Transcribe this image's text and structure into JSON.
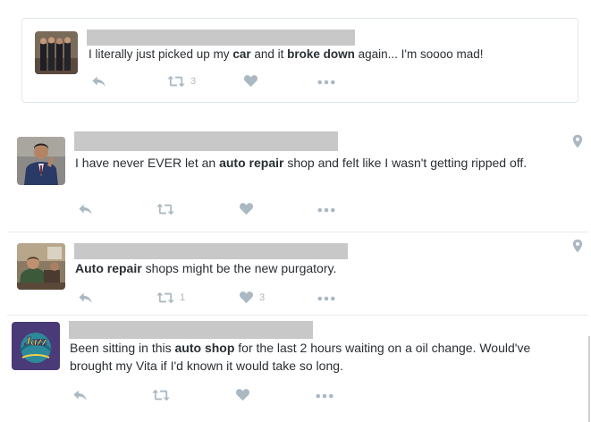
{
  "tweets": [
    {
      "text_parts": [
        {
          "t": "I literally just picked up my ",
          "b": false
        },
        {
          "t": "car",
          "b": true
        },
        {
          "t": " and it ",
          "b": false
        },
        {
          "t": "broke down",
          "b": true
        },
        {
          "t": " again... I'm soooo mad!",
          "b": false
        }
      ],
      "retweet_count": "3",
      "like_count": ""
    },
    {
      "text_parts": [
        {
          "t": "I have never EVER let an ",
          "b": false
        },
        {
          "t": "auto repair",
          "b": true
        },
        {
          "t": " shop and felt like I wasn't getting ripped off.",
          "b": false
        }
      ],
      "retweet_count": "",
      "like_count": ""
    },
    {
      "text_parts": [
        {
          "t": "Auto repair",
          "b": true
        },
        {
          "t": " shops might be the new purgatory.",
          "b": false
        }
      ],
      "retweet_count": "1",
      "like_count": "3"
    },
    {
      "text_parts": [
        {
          "t": "Been sitting in this ",
          "b": false
        },
        {
          "t": "auto shop",
          "b": true
        },
        {
          "t": " for the last 2 hours waiting on a oil change. Would've brought my Vita if I'd known it would take so long.",
          "b": false
        }
      ],
      "retweet_count": "",
      "like_count": ""
    }
  ],
  "icons": {
    "reply": "reply-icon",
    "retweet": "retweet-icon",
    "like": "heart-icon",
    "more": "more-icon",
    "location": "location-pin-icon"
  },
  "colors": {
    "icon": "#aab8c2",
    "text": "#292f33",
    "redaction": "#c8c8c8",
    "border": "#e1e8ed"
  }
}
